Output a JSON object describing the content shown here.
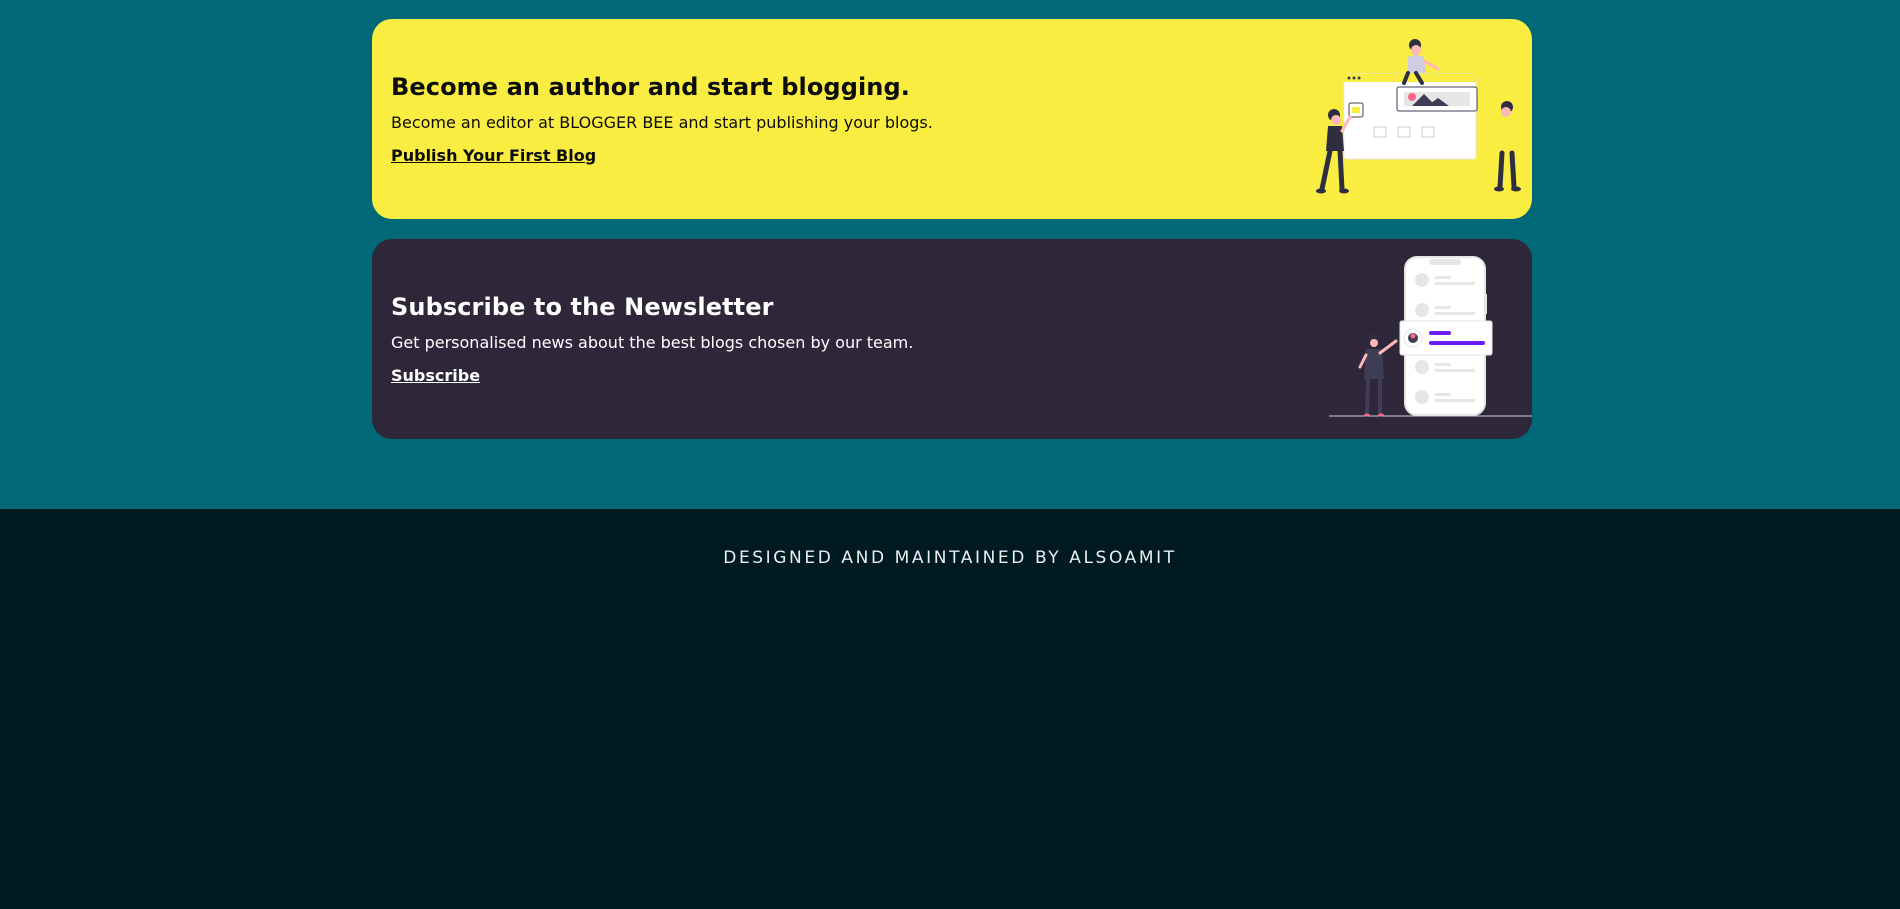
{
  "cards": {
    "author": {
      "title": "Become an author and start blogging.",
      "description": "Become an editor at BLOGGER BEE and start publishing your blogs.",
      "link_label": "Publish Your First Blog",
      "background": "#f9ed42",
      "illustration_icon": "blogging-team-illustration"
    },
    "newsletter": {
      "title": "Subscribe to the Newsletter",
      "description": "Get personalised news about the best blogs chosen by our team.",
      "link_label": "Subscribe",
      "background": "#2e2739",
      "illustration_icon": "newsletter-phone-illustration"
    }
  },
  "footer": {
    "credit": "DESIGNED AND MAINTAINED BY ALSOAMIT",
    "background": "#001a22"
  },
  "colors": {
    "page_teal": "#006877",
    "accent_purple": "#6c1df5"
  }
}
